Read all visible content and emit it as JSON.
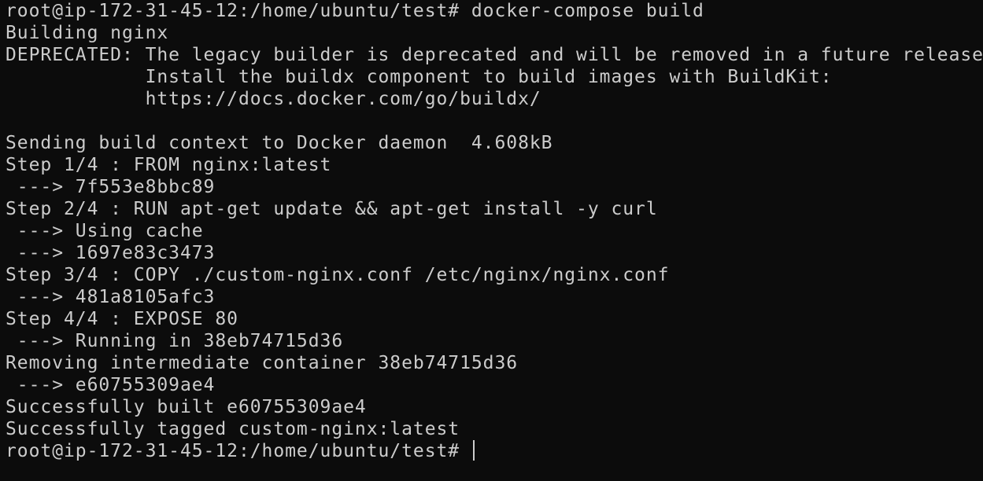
{
  "terminal": {
    "lines": [
      "root@ip-172-31-45-12:/home/ubuntu/test# docker-compose build",
      "Building nginx",
      "DEPRECATED: The legacy builder is deprecated and will be removed in a future release.",
      "            Install the buildx component to build images with BuildKit:",
      "            https://docs.docker.com/go/buildx/",
      "",
      "Sending build context to Docker daemon  4.608kB",
      "Step 1/4 : FROM nginx:latest",
      " ---> 7f553e8bbc89",
      "Step 2/4 : RUN apt-get update && apt-get install -y curl",
      " ---> Using cache",
      " ---> 1697e83c3473",
      "Step 3/4 : COPY ./custom-nginx.conf /etc/nginx/nginx.conf",
      " ---> 481a8105afc3",
      "Step 4/4 : EXPOSE 80",
      " ---> Running in 38eb74715d36",
      "Removing intermediate container 38eb74715d36",
      " ---> e60755309ae4",
      "Successfully built e60755309ae4",
      "Successfully tagged custom-nginx:latest"
    ],
    "prompt": "root@ip-172-31-45-12:/home/ubuntu/test# ",
    "colors": {
      "background": "#0c0c0c",
      "foreground": "#cccccc"
    }
  }
}
